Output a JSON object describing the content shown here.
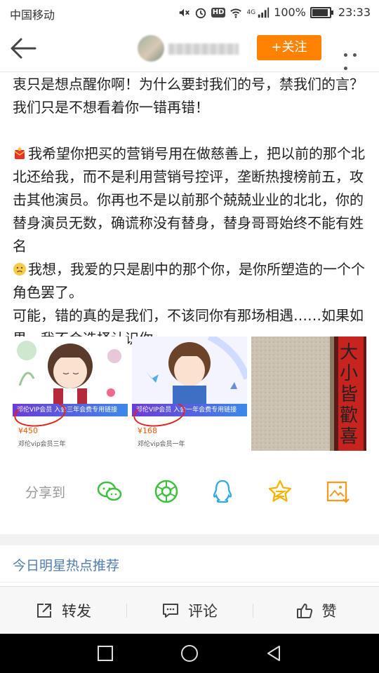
{
  "status_bar": {
    "carrier": "中国移动",
    "network": "4G",
    "battery": "100%",
    "time": "23:33",
    "icons": [
      "mute-icon",
      "alarm-icon",
      "hd-icon",
      "wifi-icon",
      "signal-icon",
      "battery-icon"
    ],
    "hd_label": "HD"
  },
  "header": {
    "back_icon": "back-arrow-icon",
    "follow_label": "+关注",
    "more_icon": "more-dots-icon",
    "accent": "#ff8200"
  },
  "post": {
    "para1": "衷只是想点醒你啊！为什么要封我们的号，禁我们的言？我们只是不想看着你一错再错！",
    "para2": "我希望你把买的营销号用在做慈善上，把以前的那个北北还给我，而不是利用营销号控评，垄断热搜榜前五，攻击其他演员。你再也不是以前那个兢兢业业的北北，你的替身演员无数，确谎称没有替身，替身哥哥始终不能有姓名",
    "para3": "我想，我爱的只是剧中的那个你，是你所塑造的一个个角色罢了。",
    "para4": "可能，错的真的是我们，不该同你有那场相遇……如果如果，我不会选择认识你。"
  },
  "images": [
    {
      "banner": "邓伦VIP会员 入会三年会费专用链接",
      "price": "¥450",
      "desc": "邓伦vip会员三年"
    },
    {
      "banner": "邓伦VIP会员 入会一年会费专用链接",
      "price": "¥168",
      "desc": "邓伦vip会员一年"
    },
    {
      "sign_text": "大小皆歡喜"
    }
  ],
  "share": {
    "label": "分享到",
    "targets": [
      "wechat-icon",
      "moments-icon",
      "qq-icon",
      "qzone-icon",
      "save-image-icon"
    ]
  },
  "hot_recommend": "今日明星热点推荐",
  "actions": {
    "repost": "转发",
    "comment": "评论",
    "like": "赞"
  },
  "colors": {
    "link_blue": "#507daf",
    "share_green": "#3fbf3f",
    "qq_blue": "#2fa8e8",
    "qzone_yellow": "#f6b400",
    "save_orange": "#f39a24"
  }
}
